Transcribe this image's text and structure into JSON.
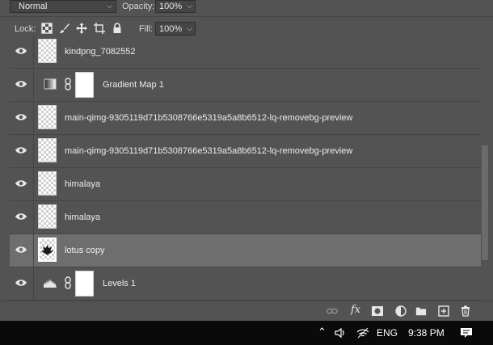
{
  "blend": {
    "mode": "Normal"
  },
  "opacity": {
    "label": "Opacity:",
    "value": "100%"
  },
  "lock": {
    "label": "Lock:"
  },
  "fill": {
    "label": "Fill:",
    "value": "100%"
  },
  "layers": [
    {
      "name": "kindpng_7082552",
      "type": "image",
      "selected": false
    },
    {
      "name": "Gradient Map 1",
      "type": "adjustment",
      "icon": "gradient-map-icon",
      "selected": false
    },
    {
      "name": "main-qimg-9305119d71b5308766e5319a5a8b6512-lq-removebg-preview",
      "type": "image",
      "selected": false
    },
    {
      "name": "main-qimg-9305119d71b5308766e5319a5a8b6512-lq-removebg-preview",
      "type": "image",
      "selected": false
    },
    {
      "name": "himalaya",
      "type": "image",
      "selected": false
    },
    {
      "name": "himalaya",
      "type": "image",
      "selected": false
    },
    {
      "name": "lotus copy",
      "type": "image",
      "selected": true
    },
    {
      "name": "Levels 1",
      "type": "adjustment",
      "icon": "levels-icon",
      "selected": false
    }
  ],
  "taskbar": {
    "language": "ENG",
    "time": "9:38 PM"
  },
  "colors": {
    "panel": "#535353",
    "selected_row": "#6e6e6e",
    "taskbar": "#0a0a0a"
  }
}
